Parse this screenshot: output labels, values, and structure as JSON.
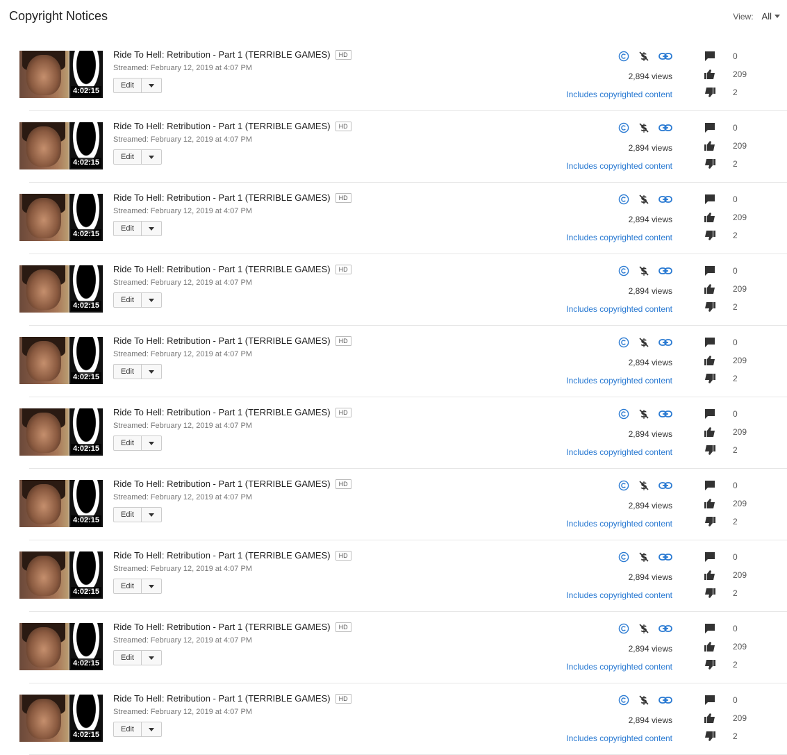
{
  "header": {
    "title": "Copyright Notices",
    "view_label": "View:",
    "view_value": "All"
  },
  "colors": {
    "accent": "#2a7ad2",
    "icon_dark": "#333333"
  },
  "videos": [
    {
      "duration": "4:02:15",
      "title": "Ride To Hell: Retribution - Part 1 (TERRIBLE GAMES)",
      "badge": "HD",
      "date": "Streamed: February 12, 2019 at 4:07 PM",
      "edit_label": "Edit",
      "views": "2,894 views",
      "copyright_text": "Includes copyrighted content",
      "comments": "0",
      "likes": "209",
      "dislikes": "2",
      "status_icons": [
        "copyright-icon",
        "monetization-off-icon",
        "link-icon"
      ]
    },
    {
      "duration": "4:02:15",
      "title": "Ride To Hell: Retribution - Part 1 (TERRIBLE GAMES)",
      "badge": "HD",
      "date": "Streamed: February 12, 2019 at 4:07 PM",
      "edit_label": "Edit",
      "views": "2,894 views",
      "copyright_text": "Includes copyrighted content",
      "comments": "0",
      "likes": "209",
      "dislikes": "2",
      "status_icons": [
        "copyright-icon",
        "monetization-off-icon",
        "link-icon"
      ]
    },
    {
      "duration": "4:02:15",
      "title": "Ride To Hell: Retribution - Part 1 (TERRIBLE GAMES)",
      "badge": "HD",
      "date": "Streamed: February 12, 2019 at 4:07 PM",
      "edit_label": "Edit",
      "views": "2,894 views",
      "copyright_text": "Includes copyrighted content",
      "comments": "0",
      "likes": "209",
      "dislikes": "2",
      "status_icons": [
        "copyright-icon",
        "monetization-off-icon",
        "link-icon"
      ]
    },
    {
      "duration": "4:02:15",
      "title": "Ride To Hell: Retribution - Part 1 (TERRIBLE GAMES)",
      "badge": "HD",
      "date": "Streamed: February 12, 2019 at 4:07 PM",
      "edit_label": "Edit",
      "views": "2,894 views",
      "copyright_text": "Includes copyrighted content",
      "comments": "0",
      "likes": "209",
      "dislikes": "2",
      "status_icons": [
        "copyright-icon",
        "monetization-off-icon",
        "link-icon"
      ]
    },
    {
      "duration": "4:02:15",
      "title": "Ride To Hell: Retribution - Part 1 (TERRIBLE GAMES)",
      "badge": "HD",
      "date": "Streamed: February 12, 2019 at 4:07 PM",
      "edit_label": "Edit",
      "views": "2,894 views",
      "copyright_text": "Includes copyrighted content",
      "comments": "0",
      "likes": "209",
      "dislikes": "2",
      "status_icons": [
        "copyright-icon",
        "monetization-off-icon",
        "link-icon"
      ]
    },
    {
      "duration": "4:02:15",
      "title": "Ride To Hell: Retribution - Part 1 (TERRIBLE GAMES)",
      "badge": "HD",
      "date": "Streamed: February 12, 2019 at 4:07 PM",
      "edit_label": "Edit",
      "views": "2,894 views",
      "copyright_text": "Includes copyrighted content",
      "comments": "0",
      "likes": "209",
      "dislikes": "2",
      "status_icons": [
        "copyright-icon",
        "monetization-off-icon",
        "link-icon"
      ]
    },
    {
      "duration": "4:02:15",
      "title": "Ride To Hell: Retribution - Part 1 (TERRIBLE GAMES)",
      "badge": "HD",
      "date": "Streamed: February 12, 2019 at 4:07 PM",
      "edit_label": "Edit",
      "views": "2,894 views",
      "copyright_text": "Includes copyrighted content",
      "comments": "0",
      "likes": "209",
      "dislikes": "2",
      "status_icons": [
        "copyright-icon",
        "monetization-off-icon",
        "link-icon"
      ]
    },
    {
      "duration": "4:02:15",
      "title": "Ride To Hell: Retribution - Part 1 (TERRIBLE GAMES)",
      "badge": "HD",
      "date": "Streamed: February 12, 2019 at 4:07 PM",
      "edit_label": "Edit",
      "views": "2,894 views",
      "copyright_text": "Includes copyrighted content",
      "comments": "0",
      "likes": "209",
      "dislikes": "2",
      "status_icons": [
        "copyright-icon",
        "monetization-off-icon",
        "link-icon"
      ]
    },
    {
      "duration": "4:02:15",
      "title": "Ride To Hell: Retribution - Part 1 (TERRIBLE GAMES)",
      "badge": "HD",
      "date": "Streamed: February 12, 2019 at 4:07 PM",
      "edit_label": "Edit",
      "views": "2,894 views",
      "copyright_text": "Includes copyrighted content",
      "comments": "0",
      "likes": "209",
      "dislikes": "2",
      "status_icons": [
        "copyright-icon",
        "monetization-off-icon",
        "link-icon"
      ]
    },
    {
      "duration": "4:02:15",
      "title": "Ride To Hell: Retribution - Part 1 (TERRIBLE GAMES)",
      "badge": "HD",
      "date": "Streamed: February 12, 2019 at 4:07 PM",
      "edit_label": "Edit",
      "views": "2,894 views",
      "copyright_text": "Includes copyrighted content",
      "comments": "0",
      "likes": "209",
      "dislikes": "2",
      "status_icons": [
        "copyright-icon",
        "monetization-off-icon",
        "link-icon"
      ]
    }
  ]
}
